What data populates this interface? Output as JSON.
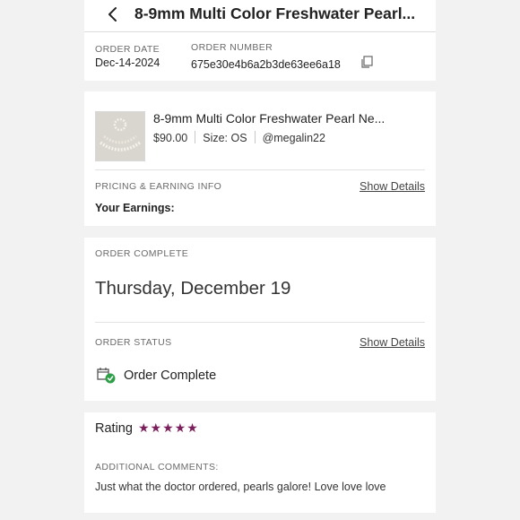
{
  "header": {
    "title": "8-9mm Multi Color Freshwater Pearl..."
  },
  "order": {
    "date_label": "ORDER DATE",
    "date": "Dec-14-2024",
    "number_label": "ORDER NUMBER",
    "number": "675e30e4b6a2b3de63ee6a18"
  },
  "product": {
    "title": "8-9mm Multi Color Freshwater Pearl Ne...",
    "price": "$90.00",
    "size": "Size: OS",
    "seller": "@megalin22"
  },
  "pricing": {
    "label": "PRICING & EARNING INFO",
    "link": "Show Details",
    "earnings_label": "Your Earnings:"
  },
  "completion": {
    "label": "ORDER COMPLETE",
    "date": "Thursday, December 19"
  },
  "status": {
    "label": "ORDER STATUS",
    "link": "Show Details",
    "text": "Order Complete",
    "icon": "order-complete-icon",
    "icon_color": "#2e9e48"
  },
  "rating": {
    "label": "Rating",
    "stars": "★★★★★",
    "score": 5,
    "max": 5,
    "star_color": "#7b1f5c"
  },
  "comments": {
    "label": "ADDITIONAL COMMENTS:",
    "text": "Just what the doctor ordered, pearls galore! Love love love"
  }
}
